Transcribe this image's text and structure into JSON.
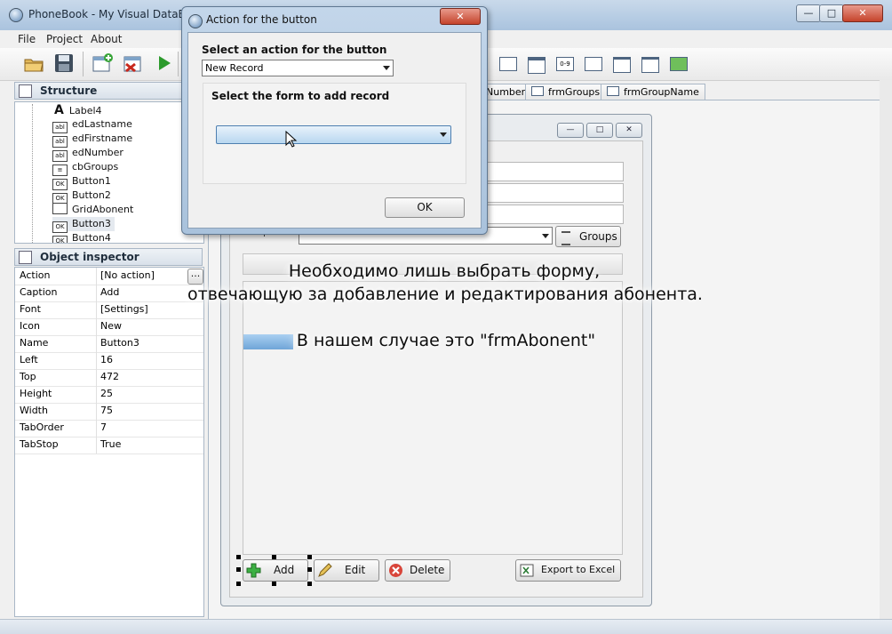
{
  "window": {
    "title": "PhoneBook - My Visual DataBas"
  },
  "menu": [
    "File",
    "Project",
    "About"
  ],
  "structure": {
    "title": "Structure",
    "items": [
      {
        "label": "Label4",
        "icon": "label-icon"
      },
      {
        "label": "edLastname",
        "icon": "edit-field-icon"
      },
      {
        "label": "edFirstname",
        "icon": "edit-field-icon"
      },
      {
        "label": "edNumber",
        "icon": "edit-field-icon"
      },
      {
        "label": "cbGroups",
        "icon": "combobox-icon"
      },
      {
        "label": "Button1",
        "icon": "button-icon"
      },
      {
        "label": "Button2",
        "icon": "button-icon"
      },
      {
        "label": "GridAbonent",
        "icon": "grid-icon"
      },
      {
        "label": "Button3",
        "icon": "button-icon"
      },
      {
        "label": "Button4",
        "icon": "button-icon"
      }
    ]
  },
  "inspector": {
    "title": "Object inspector",
    "props": [
      {
        "name": "Action",
        "value": "[No action]"
      },
      {
        "name": "Caption",
        "value": "Add"
      },
      {
        "name": "Font",
        "value": "[Settings]"
      },
      {
        "name": "Icon",
        "value": "New"
      },
      {
        "name": "Name",
        "value": "Button3"
      },
      {
        "name": "Left",
        "value": "16"
      },
      {
        "name": "Top",
        "value": "472"
      },
      {
        "name": "Height",
        "value": "25"
      },
      {
        "name": "Width",
        "value": "75"
      },
      {
        "name": "TabOrder",
        "value": "7"
      },
      {
        "name": "TabStop",
        "value": "True"
      }
    ],
    "ellipsis": "..."
  },
  "designer_tabs": [
    "Number",
    "frmGroups",
    "frmGroupName"
  ],
  "form": {
    "group_label": "Group",
    "groups_button": "Groups",
    "buttons": {
      "add": "Add",
      "edit": "Edit",
      "delete": "Delete",
      "export": "Export to Excel"
    }
  },
  "dialog": {
    "title": "Action for the button",
    "action_label": "Select an action for the button",
    "action_value": "New Record",
    "form_label": "Select the form to add record",
    "form_value": "",
    "ok": "OK"
  },
  "overlay": {
    "line1": "Необходимо лишь выбрать форму,",
    "line2": "отвечающую за добавление и редактирования абонента.",
    "line3": "В нашем случае это \"frmAbonent\""
  }
}
